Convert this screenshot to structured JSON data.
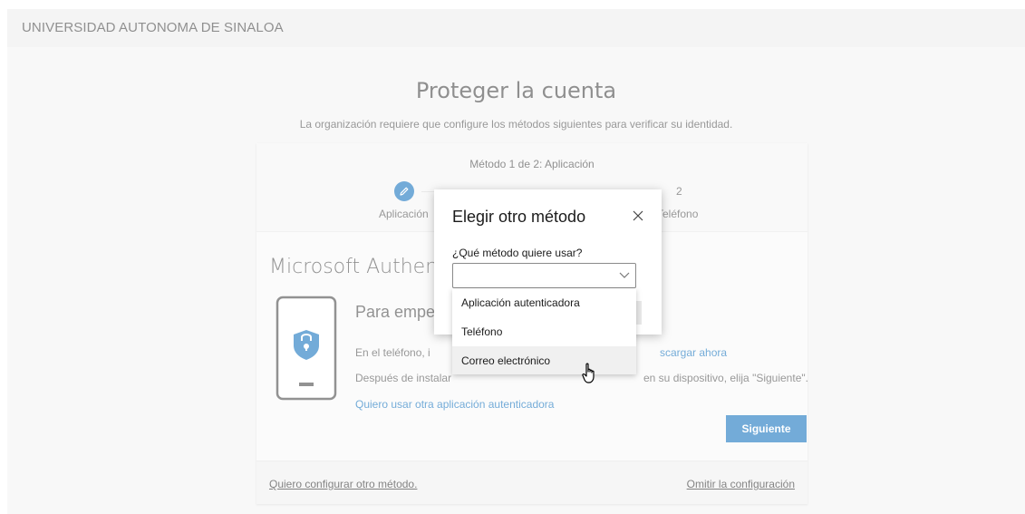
{
  "header": {
    "org_name": "UNIVERSIDAD AUTONOMA DE SINALOA"
  },
  "page": {
    "title": "Proteger la cuenta",
    "subtitle": "La organización requiere que configure los métodos siguientes para verificar su identidad."
  },
  "progress": {
    "title": "Método 1 de 2: Aplicación",
    "steps": [
      {
        "label": "Aplicación",
        "icon": "pencil-icon"
      },
      {
        "number": "2",
        "label": "Teléfono"
      }
    ]
  },
  "content": {
    "app_title": "Microsoft Authen",
    "heading": "Para empe",
    "line1_prefix": "En el teléfono, i",
    "line1_link": "scargar ahora",
    "line2_prefix": "Después de instalar",
    "line2_suffix": "en su dispositivo, elija \"Siguiente\".",
    "alt_app_link": "Quiero usar otra aplicación autenticadora",
    "next_button": "Siguiente"
  },
  "footer": {
    "other_method": "Quiero configurar otro método.",
    "skip": "Omitir la configuración"
  },
  "dialog": {
    "title": "Elegir otro método",
    "question": "¿Qué método quiere usar?",
    "selected_value": "",
    "options": [
      "Aplicación autenticadora",
      "Teléfono",
      "Correo electrónico"
    ],
    "hovered_option": "Correo electrónico"
  },
  "colors": {
    "accent": "#0067b8",
    "background": "#f2f2f2"
  }
}
